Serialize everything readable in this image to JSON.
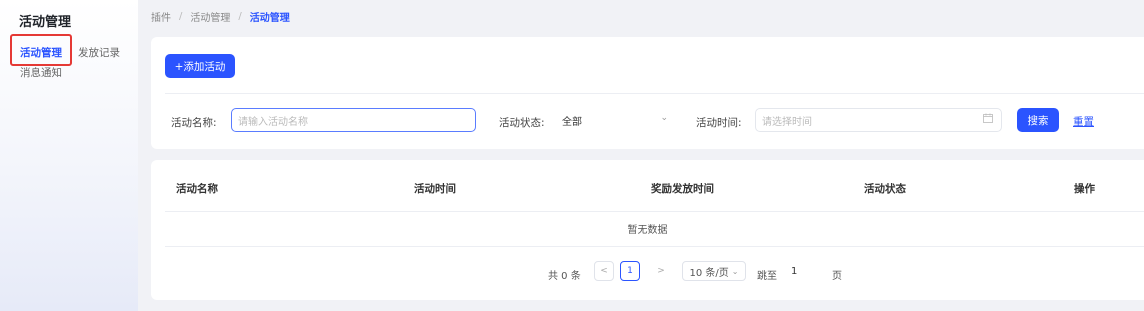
{
  "sidebar": {
    "title": "活动管理",
    "items": [
      {
        "label": "活动管理"
      },
      {
        "label": "发放记录"
      },
      {
        "label": "消息通知"
      }
    ]
  },
  "breadcrumb": {
    "items": [
      "插件",
      "活动管理",
      "活动管理"
    ],
    "separator": "/"
  },
  "toolbar": {
    "add_label": "+添加活动"
  },
  "filters": {
    "name_label": "活动名称:",
    "name_placeholder": "请输入活动名称",
    "status_label": "活动状态:",
    "status_value": "全部",
    "time_label": "活动时间:",
    "time_placeholder": "请选择时间",
    "search_label": "搜索",
    "reset_label": "重置"
  },
  "table": {
    "columns": [
      "活动名称",
      "活动时间",
      "奖励发放时间",
      "活动状态",
      "操作"
    ],
    "empty_text": "暂无数据"
  },
  "pagination": {
    "total_text": "共 0 条",
    "prev": "<",
    "current_page": "1",
    "next": ">",
    "page_size": "10 条/页",
    "goto_label": "跳至",
    "goto_value": "1",
    "page_suffix": "页"
  },
  "colors": {
    "accent": "#2b54ff",
    "highlight_box": "#e53935",
    "background": "#f1f2f6"
  }
}
